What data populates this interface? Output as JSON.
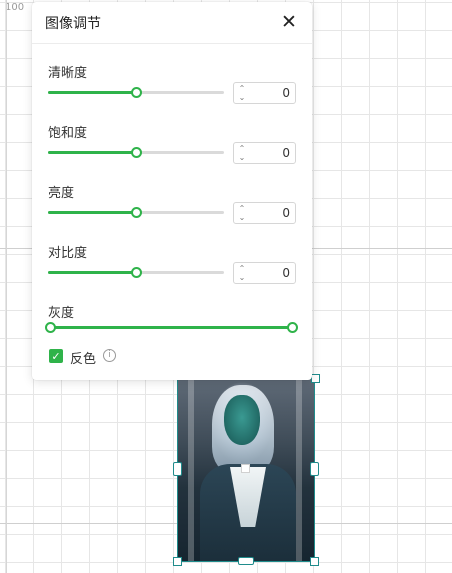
{
  "canvas": {
    "ruler_value": "100"
  },
  "panel": {
    "title": "图像调节",
    "close_icon": "✕",
    "sliders": [
      {
        "label": "清晰度",
        "value_fraction": 0.5,
        "stepper_value": "0",
        "has_stepper": true
      },
      {
        "label": "饱和度",
        "value_fraction": 0.5,
        "stepper_value": "0",
        "has_stepper": true
      },
      {
        "label": "亮度",
        "value_fraction": 0.5,
        "stepper_value": "0",
        "has_stepper": true
      },
      {
        "label": "对比度",
        "value_fraction": 0.5,
        "stepper_value": "0",
        "has_stepper": true
      }
    ],
    "gray": {
      "label": "灰度",
      "range_start": 0.0,
      "range_end": 1.0
    },
    "invert": {
      "label": "反色",
      "checked": true,
      "check_glyph": "✓",
      "info_glyph": "i"
    },
    "stepper_arrows": {
      "up": "⌃",
      "down": "⌄"
    }
  },
  "colors": {
    "accent": "#2fb34a",
    "selection": "#1f8c8c"
  }
}
